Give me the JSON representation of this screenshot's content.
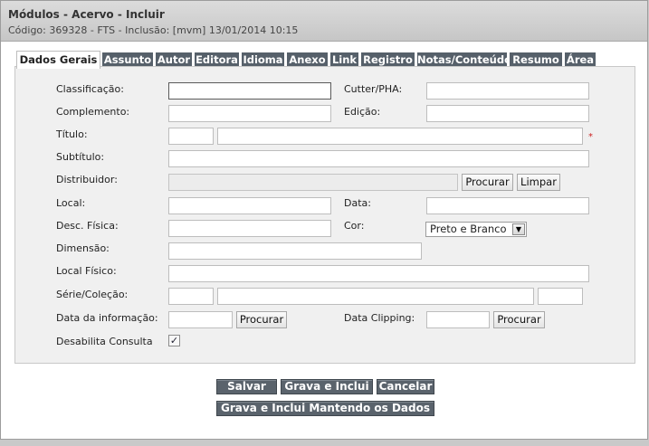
{
  "header": {
    "title": "Módulos - Acervo - Incluir",
    "subtitle": "Código: 369328 - FTS - Inclusão: [mvm] 13/01/2014 10:15"
  },
  "tabs": [
    "Dados Gerais",
    "Assunto",
    "Autor",
    "Editora",
    "Idioma",
    "Anexo",
    "Link",
    "Registro",
    "Notas/Conteúdo",
    "Resumo",
    "Área"
  ],
  "form": {
    "classificacao": "Classificação:",
    "cutter": "Cutter/PHA:",
    "complemento": "Complemento:",
    "edicao": "Edição:",
    "titulo": "Título:",
    "subtitulo": "Subtítulo:",
    "distribuidor": "Distribuidor:",
    "local": "Local:",
    "data": "Data:",
    "desc_fisica": "Desc. Física:",
    "cor": "Cor:",
    "cor_value": "Preto e Branco",
    "dimensao": "Dimensão:",
    "local_fisico": "Local Físico:",
    "serie": "Série/Coleção:",
    "data_info": "Data da informação:",
    "data_clipping": "Data Clipping:",
    "desabilita": "Desabilita Consulta",
    "required_mark": "*",
    "check_mark": "✓"
  },
  "buttons": {
    "procurar": "Procurar",
    "limpar": "Limpar",
    "salvar": "Salvar",
    "grava_inclui": "Grava e Inclui",
    "cancelar": "Cancelar",
    "grava_mantendo": "Grava e Inclui Mantendo os Dados"
  }
}
